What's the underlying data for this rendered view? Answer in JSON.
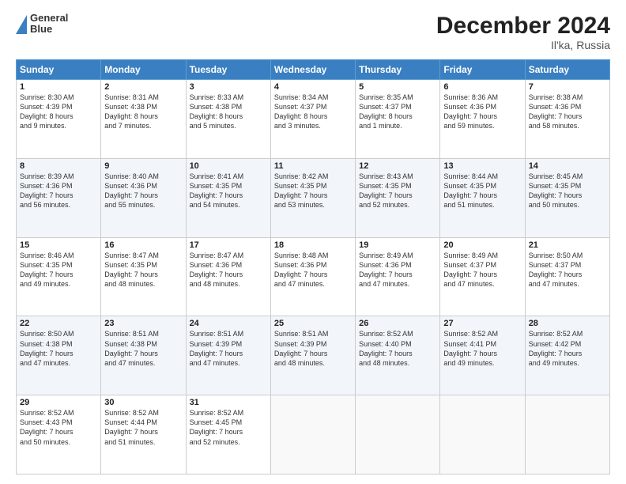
{
  "header": {
    "logo_line1": "General",
    "logo_line2": "Blue",
    "title": "December 2024",
    "subtitle": "Il'ka, Russia"
  },
  "days_of_week": [
    "Sunday",
    "Monday",
    "Tuesday",
    "Wednesday",
    "Thursday",
    "Friday",
    "Saturday"
  ],
  "weeks": [
    [
      {
        "day": "1",
        "lines": [
          "Sunrise: 8:30 AM",
          "Sunset: 4:39 PM",
          "Daylight: 8 hours",
          "and 9 minutes."
        ]
      },
      {
        "day": "2",
        "lines": [
          "Sunrise: 8:31 AM",
          "Sunset: 4:38 PM",
          "Daylight: 8 hours",
          "and 7 minutes."
        ]
      },
      {
        "day": "3",
        "lines": [
          "Sunrise: 8:33 AM",
          "Sunset: 4:38 PM",
          "Daylight: 8 hours",
          "and 5 minutes."
        ]
      },
      {
        "day": "4",
        "lines": [
          "Sunrise: 8:34 AM",
          "Sunset: 4:37 PM",
          "Daylight: 8 hours",
          "and 3 minutes."
        ]
      },
      {
        "day": "5",
        "lines": [
          "Sunrise: 8:35 AM",
          "Sunset: 4:37 PM",
          "Daylight: 8 hours",
          "and 1 minute."
        ]
      },
      {
        "day": "6",
        "lines": [
          "Sunrise: 8:36 AM",
          "Sunset: 4:36 PM",
          "Daylight: 7 hours",
          "and 59 minutes."
        ]
      },
      {
        "day": "7",
        "lines": [
          "Sunrise: 8:38 AM",
          "Sunset: 4:36 PM",
          "Daylight: 7 hours",
          "and 58 minutes."
        ]
      }
    ],
    [
      {
        "day": "8",
        "lines": [
          "Sunrise: 8:39 AM",
          "Sunset: 4:36 PM",
          "Daylight: 7 hours",
          "and 56 minutes."
        ]
      },
      {
        "day": "9",
        "lines": [
          "Sunrise: 8:40 AM",
          "Sunset: 4:36 PM",
          "Daylight: 7 hours",
          "and 55 minutes."
        ]
      },
      {
        "day": "10",
        "lines": [
          "Sunrise: 8:41 AM",
          "Sunset: 4:35 PM",
          "Daylight: 7 hours",
          "and 54 minutes."
        ]
      },
      {
        "day": "11",
        "lines": [
          "Sunrise: 8:42 AM",
          "Sunset: 4:35 PM",
          "Daylight: 7 hours",
          "and 53 minutes."
        ]
      },
      {
        "day": "12",
        "lines": [
          "Sunrise: 8:43 AM",
          "Sunset: 4:35 PM",
          "Daylight: 7 hours",
          "and 52 minutes."
        ]
      },
      {
        "day": "13",
        "lines": [
          "Sunrise: 8:44 AM",
          "Sunset: 4:35 PM",
          "Daylight: 7 hours",
          "and 51 minutes."
        ]
      },
      {
        "day": "14",
        "lines": [
          "Sunrise: 8:45 AM",
          "Sunset: 4:35 PM",
          "Daylight: 7 hours",
          "and 50 minutes."
        ]
      }
    ],
    [
      {
        "day": "15",
        "lines": [
          "Sunrise: 8:46 AM",
          "Sunset: 4:35 PM",
          "Daylight: 7 hours",
          "and 49 minutes."
        ]
      },
      {
        "day": "16",
        "lines": [
          "Sunrise: 8:47 AM",
          "Sunset: 4:35 PM",
          "Daylight: 7 hours",
          "and 48 minutes."
        ]
      },
      {
        "day": "17",
        "lines": [
          "Sunrise: 8:47 AM",
          "Sunset: 4:36 PM",
          "Daylight: 7 hours",
          "and 48 minutes."
        ]
      },
      {
        "day": "18",
        "lines": [
          "Sunrise: 8:48 AM",
          "Sunset: 4:36 PM",
          "Daylight: 7 hours",
          "and 47 minutes."
        ]
      },
      {
        "day": "19",
        "lines": [
          "Sunrise: 8:49 AM",
          "Sunset: 4:36 PM",
          "Daylight: 7 hours",
          "and 47 minutes."
        ]
      },
      {
        "day": "20",
        "lines": [
          "Sunrise: 8:49 AM",
          "Sunset: 4:37 PM",
          "Daylight: 7 hours",
          "and 47 minutes."
        ]
      },
      {
        "day": "21",
        "lines": [
          "Sunrise: 8:50 AM",
          "Sunset: 4:37 PM",
          "Daylight: 7 hours",
          "and 47 minutes."
        ]
      }
    ],
    [
      {
        "day": "22",
        "lines": [
          "Sunrise: 8:50 AM",
          "Sunset: 4:38 PM",
          "Daylight: 7 hours",
          "and 47 minutes."
        ]
      },
      {
        "day": "23",
        "lines": [
          "Sunrise: 8:51 AM",
          "Sunset: 4:38 PM",
          "Daylight: 7 hours",
          "and 47 minutes."
        ]
      },
      {
        "day": "24",
        "lines": [
          "Sunrise: 8:51 AM",
          "Sunset: 4:39 PM",
          "Daylight: 7 hours",
          "and 47 minutes."
        ]
      },
      {
        "day": "25",
        "lines": [
          "Sunrise: 8:51 AM",
          "Sunset: 4:39 PM",
          "Daylight: 7 hours",
          "and 48 minutes."
        ]
      },
      {
        "day": "26",
        "lines": [
          "Sunrise: 8:52 AM",
          "Sunset: 4:40 PM",
          "Daylight: 7 hours",
          "and 48 minutes."
        ]
      },
      {
        "day": "27",
        "lines": [
          "Sunrise: 8:52 AM",
          "Sunset: 4:41 PM",
          "Daylight: 7 hours",
          "and 49 minutes."
        ]
      },
      {
        "day": "28",
        "lines": [
          "Sunrise: 8:52 AM",
          "Sunset: 4:42 PM",
          "Daylight: 7 hours",
          "and 49 minutes."
        ]
      }
    ],
    [
      {
        "day": "29",
        "lines": [
          "Sunrise: 8:52 AM",
          "Sunset: 4:43 PM",
          "Daylight: 7 hours",
          "and 50 minutes."
        ]
      },
      {
        "day": "30",
        "lines": [
          "Sunrise: 8:52 AM",
          "Sunset: 4:44 PM",
          "Daylight: 7 hours",
          "and 51 minutes."
        ]
      },
      {
        "day": "31",
        "lines": [
          "Sunrise: 8:52 AM",
          "Sunset: 4:45 PM",
          "Daylight: 7 hours",
          "and 52 minutes."
        ]
      },
      null,
      null,
      null,
      null
    ]
  ]
}
